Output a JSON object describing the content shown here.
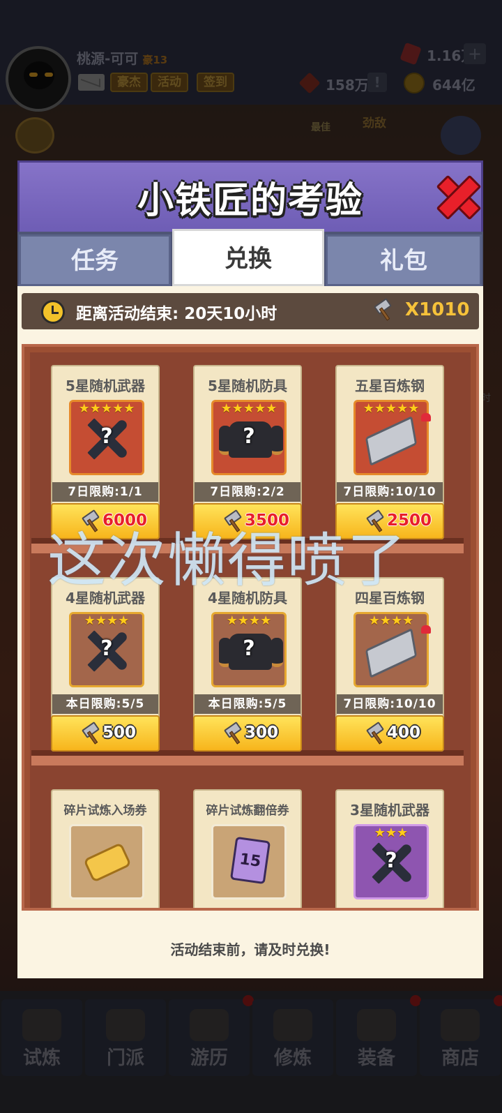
{
  "hud": {
    "player_name": "桃源-可可",
    "player_rank": "豪13",
    "btn_hero": "豪杰",
    "btn_event": "活动",
    "btn_checkin": "签到",
    "gem_amount": "1.16万",
    "plus": "+",
    "red_amount": "158万",
    "exclaim": "!",
    "gold_amount": "644亿",
    "best_label": "最佳",
    "boss_label": "劲敌",
    "side_label": "时"
  },
  "modal": {
    "title": "小铁匠的考验",
    "tabs": {
      "task": "任务",
      "exchange": "兑换",
      "gift": "礼包"
    },
    "selected_tab": "兑换",
    "timer_text": "距离活动结束: 20天10小时",
    "currency_amount": "X1010",
    "footer_note": "活动结束前，请及时兑换!",
    "items": [
      {
        "name": "5星随机武器",
        "stars": "★★★★★",
        "limit": "7日限购:1/1",
        "price": "6000",
        "affordable": false
      },
      {
        "name": "5星随机防具",
        "stars": "★★★★★",
        "limit": "7日限购:2/2",
        "price": "3500",
        "affordable": false
      },
      {
        "name": "五星百炼钢",
        "stars": "★★★★★",
        "limit": "7日限购:10/10",
        "price": "2500",
        "affordable": false
      },
      {
        "name": "4星随机武器",
        "stars": "★★★★",
        "limit": "本日限购:5/5",
        "price": "500",
        "affordable": true
      },
      {
        "name": "4星随机防具",
        "stars": "★★★★",
        "limit": "本日限购:5/5",
        "price": "300",
        "affordable": true
      },
      {
        "name": "四星百炼钢",
        "stars": "★★★★",
        "limit": "7日限购:10/10",
        "price": "400",
        "affordable": true
      },
      {
        "name": "碎片试炼入场券",
        "stars": ""
      },
      {
        "name": "碎片试炼翻倍券",
        "stars": "",
        "icon_text": "15"
      },
      {
        "name": "3星随机武器",
        "stars": "★★★"
      }
    ]
  },
  "nav": [
    "试炼",
    "门派",
    "游历",
    "修炼",
    "装备",
    "商店"
  ],
  "watermark": "这次懒得喷了",
  "colors": {
    "header_purple": "#7a68bf",
    "price_yellow": "#f7c12a",
    "shelf_brown": "#9c4f33",
    "close_red": "#e8202a"
  }
}
